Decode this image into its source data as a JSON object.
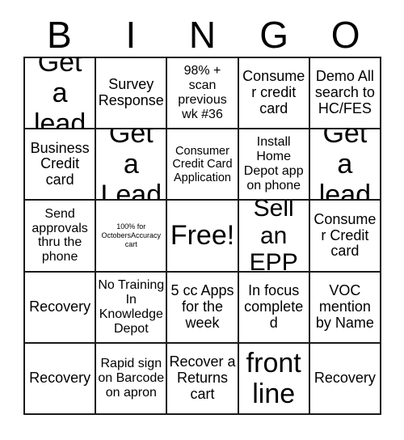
{
  "card": {
    "type": "bingo-card",
    "columns": 5,
    "rows": 5,
    "background_color": "#ffffff",
    "border_color": "#1a1a1a",
    "text_color": "#000000"
  },
  "header": {
    "letters": [
      {
        "label": "B"
      },
      {
        "label": "I"
      },
      {
        "label": "N"
      },
      {
        "label": "G"
      },
      {
        "label": "O"
      }
    ]
  },
  "grid": {
    "cells": [
      {
        "text": "Get a lead",
        "size": "t-xxl",
        "free": false
      },
      {
        "text": "Survey Response",
        "size": "t-md",
        "free": false
      },
      {
        "text": "98% + scan previous wk #36",
        "size": "t-sm",
        "free": false
      },
      {
        "text": "Consumer credit card",
        "size": "t-md",
        "free": false
      },
      {
        "text": "Demo All search to HC/FES",
        "size": "t-md",
        "free": false
      },
      {
        "text": "Business Credit card",
        "size": "t-md",
        "free": false
      },
      {
        "text": "Get a Lead",
        "size": "t-xxl",
        "free": false
      },
      {
        "text": "Consumer Credit Card Application",
        "size": "t-xs",
        "free": false
      },
      {
        "text": "Install Home Depot app on phone",
        "size": "t-sm",
        "free": false
      },
      {
        "text": "Get a lead",
        "size": "t-xxl",
        "free": false
      },
      {
        "text": "Send approvals thru the phone",
        "size": "t-sm",
        "free": false
      },
      {
        "text": "100% for OctobersAccuracy cart",
        "size": "t-tiny",
        "free": false
      },
      {
        "text": "Free!",
        "size": "t-xxl",
        "free": true
      },
      {
        "text": "Sell an EPP",
        "size": "t-xl",
        "free": false
      },
      {
        "text": "Consumer Credit card",
        "size": "t-md",
        "free": false
      },
      {
        "text": "Recovery",
        "size": "t-md",
        "free": false
      },
      {
        "text": "No Training In Knowledge Depot",
        "size": "t-sm",
        "free": false
      },
      {
        "text": "5 cc Apps for the week",
        "size": "t-md",
        "free": false
      },
      {
        "text": "In focus completed",
        "size": "t-md",
        "free": false
      },
      {
        "text": "VOC mention by Name",
        "size": "t-md",
        "free": false
      },
      {
        "text": "Recovery",
        "size": "t-md",
        "free": false
      },
      {
        "text": "Rapid sign on Barcode on apron",
        "size": "t-sm",
        "free": false
      },
      {
        "text": "Recover a Returns cart",
        "size": "t-md",
        "free": false
      },
      {
        "text": "front line",
        "size": "t-xxl",
        "free": false
      },
      {
        "text": "Recovery",
        "size": "t-md",
        "free": false
      }
    ]
  }
}
